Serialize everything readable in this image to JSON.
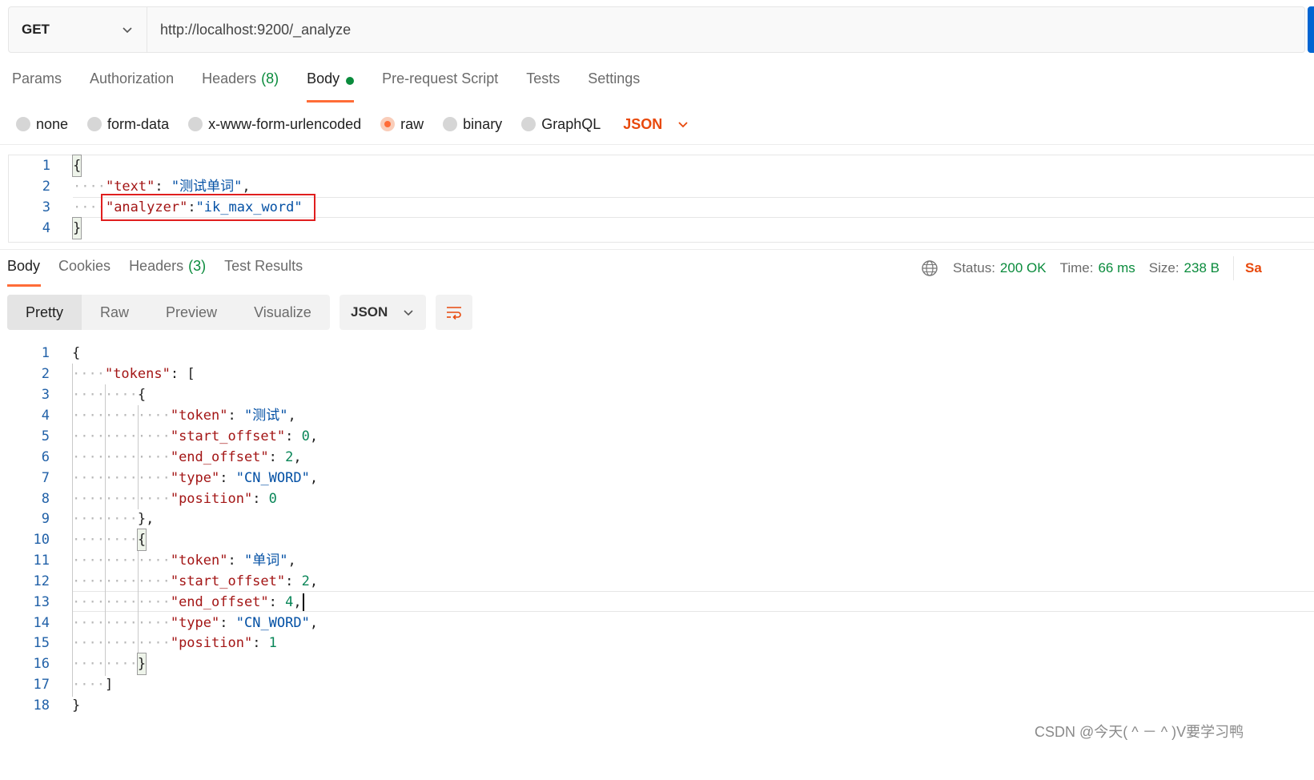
{
  "request": {
    "method": "GET",
    "url": "http://localhost:9200/_analyze",
    "tabs": [
      {
        "label": "Params"
      },
      {
        "label": "Authorization"
      },
      {
        "label": "Headers",
        "count": "(8)"
      },
      {
        "label": "Body",
        "active": true
      },
      {
        "label": "Pre-request Script"
      },
      {
        "label": "Tests"
      },
      {
        "label": "Settings"
      }
    ],
    "body_types": [
      "none",
      "form-data",
      "x-www-form-urlencoded",
      "raw",
      "binary",
      "GraphQL"
    ],
    "selected_body_type": "raw",
    "body_format": "JSON",
    "body_lines": [
      {
        "n": "1",
        "text": "{"
      },
      {
        "n": "2",
        "key": "\"text\"",
        "value": "\"测试单词\""
      },
      {
        "n": "3",
        "key": "\"analyzer\"",
        "value": "\"ik_max_word\""
      },
      {
        "n": "4",
        "text": "}"
      }
    ]
  },
  "response": {
    "tabs": [
      {
        "label": "Body",
        "active": true
      },
      {
        "label": "Cookies"
      },
      {
        "label": "Headers",
        "count": "(3)"
      },
      {
        "label": "Test Results"
      }
    ],
    "status_label": "Status:",
    "status_value": "200 OK",
    "time_label": "Time:",
    "time_value": "66 ms",
    "size_label": "Size:",
    "size_value": "238 B",
    "save_truncated": "Sa",
    "view_modes": [
      "Pretty",
      "Raw",
      "Preview",
      "Visualize"
    ],
    "format": "JSON",
    "line_numbers": [
      "1",
      "2",
      "3",
      "4",
      "5",
      "6",
      "7",
      "8",
      "9",
      "10",
      "11",
      "12",
      "13",
      "14",
      "15",
      "16",
      "17",
      "18"
    ],
    "tokens": [
      {
        "token": "\"测试\"",
        "start_offset": "0",
        "end_offset": "2",
        "type": "\"CN_WORD\"",
        "position": "0"
      },
      {
        "token": "\"单词\"",
        "start_offset": "2",
        "end_offset": "4",
        "type": "\"CN_WORD\"",
        "position": "1"
      }
    ],
    "keys": {
      "tokens": "\"tokens\"",
      "token": "\"token\"",
      "start_offset": "\"start_offset\"",
      "end_offset": "\"end_offset\"",
      "type": "\"type\"",
      "position": "\"position\""
    }
  },
  "watermark": "CSDN @今天( ^ － ^ )V要学习鸭",
  "colors": {
    "accent": "#ff6c37",
    "status_green": "#0a8b3c",
    "json_key": "#a31515",
    "json_string": "#0451a5",
    "json_number": "#098658",
    "highlight_box": "#e01e1e"
  }
}
